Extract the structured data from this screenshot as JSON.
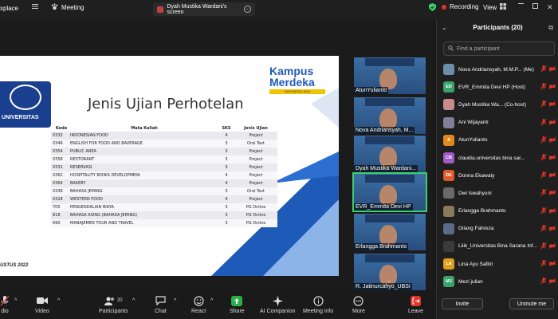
{
  "topbar": {
    "app_name": "xplace",
    "meeting_label": "Meeting",
    "share_label": "Dyah Mustika Wardani's screen",
    "recording_label": "Recording",
    "view_label": "View"
  },
  "slide": {
    "title": "Jenis Ujian Perhotelan",
    "left_logo_text": "UNIVERSITAS",
    "right_logo": {
      "line1": "Kampus",
      "line2": "Merdeka",
      "tagline": "INDONESIA JAYA"
    },
    "footer_text": "USTUS 2022",
    "table": {
      "headers": [
        "Kode",
        "Mata Kuliah",
        "SKS",
        "Jenis Ujian"
      ],
      "rows": [
        [
          "0332",
          "INDONESIAN FOOD",
          "4",
          "Project"
        ],
        [
          "0346",
          "ENGLISH FOR FOOD AND BAVERAGE",
          "3",
          "Oral Test"
        ],
        [
          "0354",
          "PUBLIC AREA",
          "3",
          "Project"
        ],
        [
          "0358",
          "RESTORANT",
          "3",
          "Project"
        ],
        [
          "0331",
          "RESERVASI",
          "3",
          "Project"
        ],
        [
          "0362",
          "HOSPITALITY BISNIS DEVELOPMENt",
          "4",
          "Project"
        ],
        [
          "0364",
          "BAKERY",
          "4",
          "Project"
        ],
        [
          "0336",
          "BAHASA JEPANG",
          "3",
          "Oral Test"
        ],
        [
          "0328",
          "WESTERN FOOD",
          "4",
          "Project"
        ],
        [
          "705",
          "PENGENDALIAN BIAYA",
          "3",
          "PG Online"
        ],
        [
          "818",
          "BAHASA ASING (BAHASA JEPANG)",
          "3",
          "PG Online"
        ],
        [
          "690",
          "MANAJEMEN TOUR AND TRAVEL",
          "3",
          "PG Online"
        ]
      ]
    }
  },
  "tiles": [
    {
      "name": "AtunYulianto"
    },
    {
      "name": "Nova Andriansyah, M..."
    },
    {
      "name": "Dyah Mustika Wardani..."
    },
    {
      "name": "EVR_Emmita Devi HP"
    },
    {
      "name": "Erlangga Brahmanto"
    },
    {
      "name": "R. Jatinurcahyo_UBSI"
    }
  ],
  "panel": {
    "title": "Participants (20)",
    "search_placeholder": "Find a participant",
    "participants": [
      {
        "avatar": "",
        "name": "Nova Andriansyah, M.M.P... (Me)",
        "color": "#6b8fa8"
      },
      {
        "avatar": "ED",
        "name": "EVR_Emmita Devi HP (Host)",
        "color": "#3aa36c"
      },
      {
        "avatar": "",
        "name": "Dyah Mustika Wa... (Co-host)",
        "color": "#c78a8a"
      },
      {
        "avatar": "",
        "name": "Ani Wijayanti",
        "color": "#7f7f9a"
      },
      {
        "avatar": "A",
        "name": "AtunYulianto",
        "color": "#e08a1e"
      },
      {
        "avatar": "CB",
        "name": "claudia.universitas bina sar...",
        "color": "#a05bc7"
      },
      {
        "avatar": "DE",
        "name": "Donna Ekawaty",
        "color": "#e05a2a"
      },
      {
        "avatar": "",
        "name": "Dwi Iswahyuni",
        "color": "#6a6a6a"
      },
      {
        "avatar": "",
        "name": "Erlangga Brahmanto",
        "color": "#8a7a5a"
      },
      {
        "avatar": "",
        "name": "Gilang Fahreza",
        "color": "#5a6a8a"
      },
      {
        "avatar": "",
        "name": "Liiik_Universitas Bina Sarana Inf...",
        "color": "#3a3a3a"
      },
      {
        "avatar": "LA",
        "name": "Lina Ayu Safitri",
        "color": "#e0a01e"
      },
      {
        "avatar": "MJ",
        "name": "Mezi julian",
        "color": "#3aa36c"
      }
    ],
    "invite_label": "Invite",
    "unmute_label": "Unmute me"
  },
  "toolbar": {
    "audio_label": "dio",
    "video_label": "Video",
    "participants_label": "Participants",
    "participants_count": "20",
    "chat_label": "Chat",
    "react_label": "React",
    "share_label": "Share",
    "ai_label": "AI Companion",
    "meeting_info_label": "Meeting info",
    "more_label": "More",
    "leave_label": "Leave"
  },
  "colors": {
    "accent_green": "#3ad16a",
    "leave_red": "#e0352b",
    "share_green": "#2bb04a",
    "muted_red": "#e0352b"
  }
}
